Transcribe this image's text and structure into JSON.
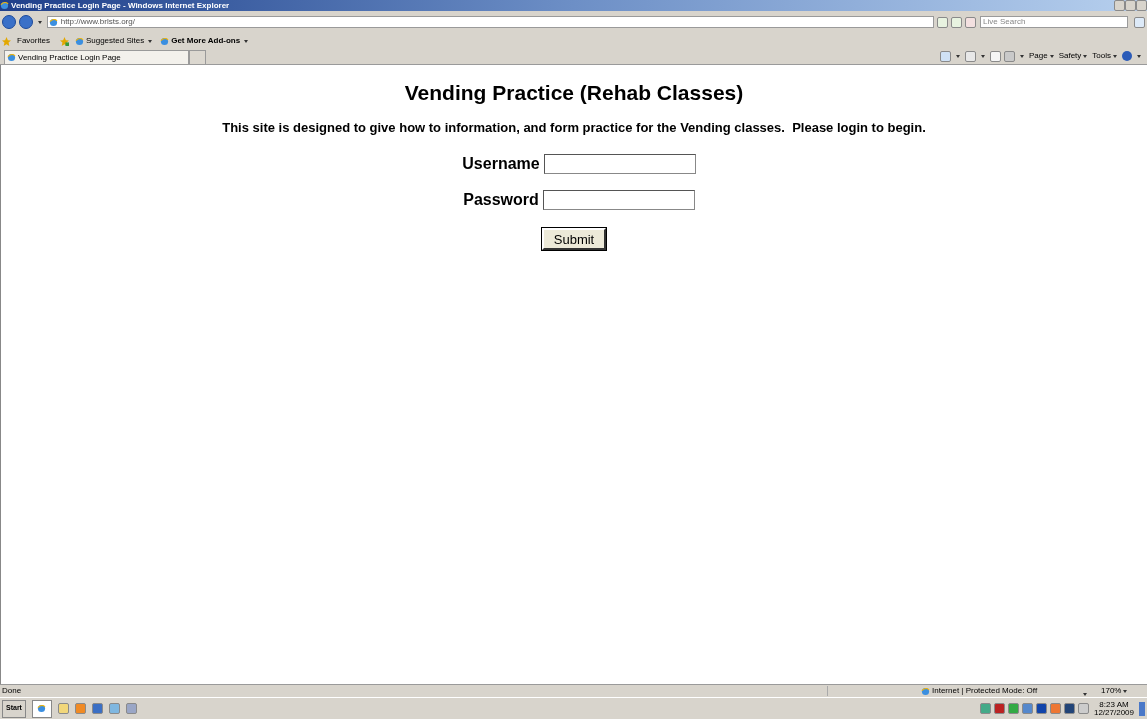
{
  "window": {
    "title": "Vending Practice Login Page - Windows Internet Explorer"
  },
  "address_bar": {
    "value": "http://www.brlsts.org/"
  },
  "search": {
    "placeholder": "Live Search"
  },
  "favorites_bar": {
    "label": "Favorites",
    "links": [
      {
        "label": "Suggested Sites",
        "bold": false
      },
      {
        "label": "Get More Add-ons",
        "bold": true
      }
    ]
  },
  "tabs": [
    {
      "label": "Vending Practice Login Page",
      "selected": true
    }
  ],
  "command_bar": [
    "Page",
    "Safety",
    "Tools"
  ],
  "page": {
    "heading": "Vending Practice (Rehab Classes)",
    "intro": "This site is designed to give how to information, and form practice for the Vending classes.  Please login to begin.",
    "fields": [
      {
        "label": "Username"
      },
      {
        "label": "Password"
      }
    ],
    "submit": "Submit"
  },
  "status_bar": {
    "text": "Done",
    "zone": "Internet | Protected Mode: Off",
    "zoom": "170%"
  },
  "taskbar": {
    "start": "Start",
    "time": "8:23 AM",
    "date": "12/27/2009"
  }
}
